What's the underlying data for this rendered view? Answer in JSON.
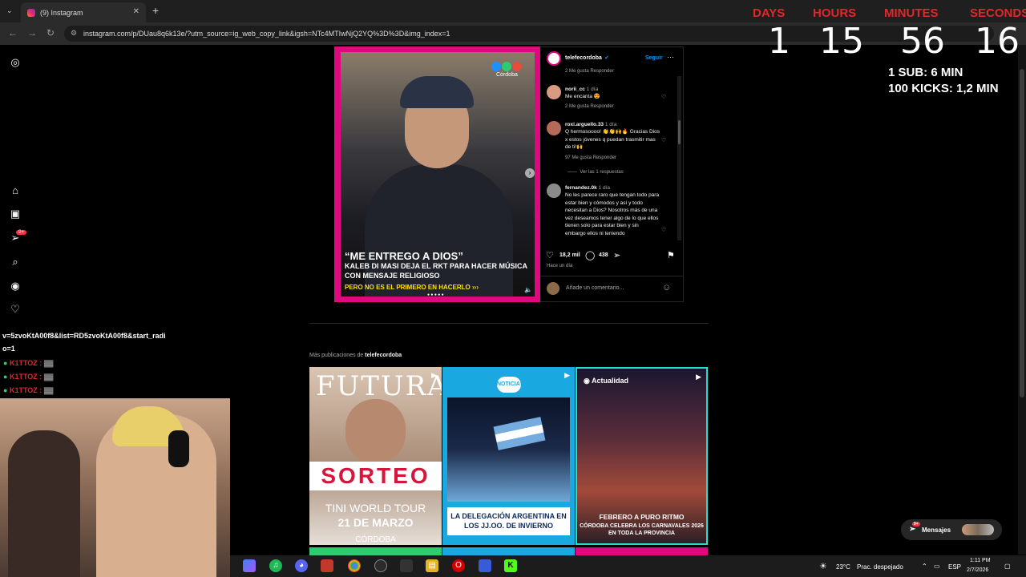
{
  "browser": {
    "tab_title": "(9) Instagram",
    "url": "instagram.com/p/DUau8q6k13e/?utm_source=ig_web_copy_link&igsh=NTc4MTIwNjQ2YQ%3D%3D&img_index=1"
  },
  "countdown": {
    "labels": [
      "DAYS",
      "HOURS",
      "MINUTES",
      "SECONDS"
    ],
    "values": [
      "1",
      "15",
      "56",
      "16"
    ],
    "rate1": "1 SUB: 6 MIN",
    "rate2": "100 KICKS: 1,2 MIN"
  },
  "nav": {
    "notification_badge": "9+"
  },
  "post": {
    "account": "telefecordoba",
    "follow_label": "Seguir",
    "headline": "“ME ENTREGO A DIOS”",
    "subheadline": "KALEB DI MASI DEJA EL RKT PARA HACER MÚSICA CON MENSAJE RELIGIOSO",
    "footer_line": "PERO NO ES EL PRIMERO EN HACERLO ›››",
    "channel_logo_text": "Córdoba",
    "top_meta": "2 Me gusta   Responder",
    "comments": [
      {
        "user": "norii_cc",
        "time": "1 día",
        "text": "Me encanta 😍",
        "meta": "2 Me gusta   Responder"
      },
      {
        "user": "roxi.arguello.33",
        "time": "1 día",
        "text": "Q hermosoooo! 👏👏🙌🔥 Gracias Dios x estos jóvenes q puedan trasmitir mas de ti!🙌",
        "meta": "97 Me gusta   Responder",
        "replies": "Ver las 1 respuestas"
      },
      {
        "user": "fernandez.0k",
        "time": "1 día",
        "text": "No les parece raro que tengan todo para estar bien y cómodos y así y todo necesitan a Dios? Nosotros más de una vez deseamos tener algo de lo que ellos tienen solo para estar bien y sin embargo ellos ni teniendo"
      }
    ],
    "likes": "18,2 mil",
    "comment_count": "438",
    "posted_ago": "Hace un día",
    "add_comment_placeholder": "Añade un comentario..."
  },
  "more": {
    "prefix": "Más publicaciones de",
    "account": "telefecordoba",
    "grid": [
      {
        "title": "FUTURA",
        "banner": "SORTEO",
        "line1": "TINI WORLD TOUR",
        "line2": "21 DE MARZO",
        "line3": "CÓRDOBA"
      },
      {
        "logo": "NOTICIAS",
        "text": "LA DELEGACIÓN ARGENTINA EN LOS JJ.OO. DE INVIERNO"
      },
      {
        "tag": "Actualidad",
        "title": "FEBRERO A PURO RITMO",
        "text": "CÓRDOBA CELEBRA LOS CARNAVALES 2026 EN TODA LA PROVINCIA"
      }
    ]
  },
  "messages": {
    "label": "Mensajes",
    "badge": "9+"
  },
  "stream": {
    "yt_url_line1": "v=5zvoKtA00f8&list=RD5zvoKtA00f8&start_radi",
    "yt_url_line2": "o=1",
    "chat": [
      "K1TTOZ :",
      "K1TTOZ :",
      "K1TTOZ :"
    ]
  },
  "taskbar": {
    "weather_temp": "23°C",
    "weather_desc": "Prac. despejado",
    "lang": "ESP",
    "time": "1:11 PM",
    "date": "2/7/2026"
  }
}
